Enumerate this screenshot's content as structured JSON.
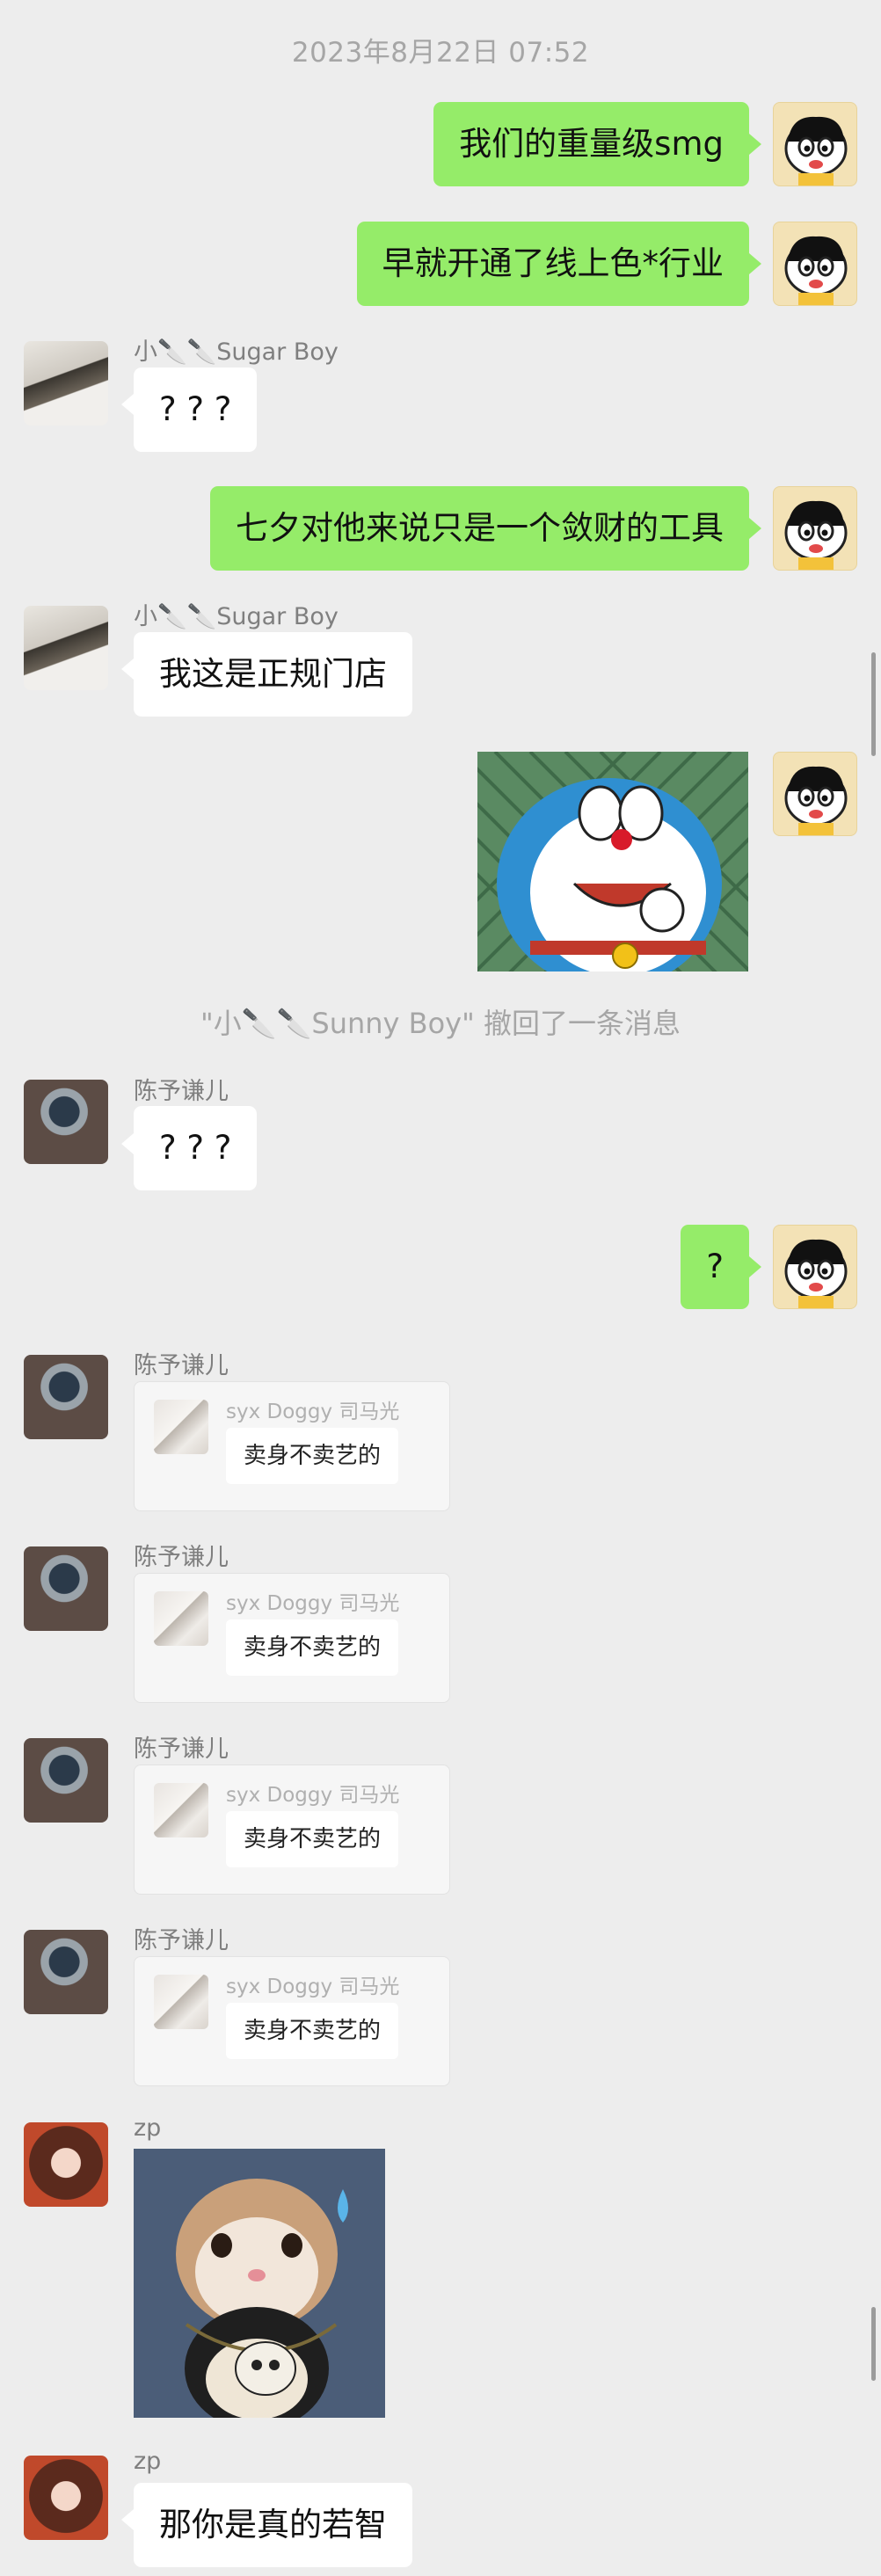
{
  "header": {
    "timestamp": "2023年8月22日 07:52"
  },
  "names": {
    "sugar": "小🔪🔪Sugar Boy",
    "chen": "陈予谦儿",
    "zp": "zp"
  },
  "messages": {
    "m1": "我们的重量级smg",
    "m2": "早就开通了线上色*行业",
    "m3": "? ? ?",
    "m4": "七夕对他来说只是一个敛财的工具",
    "m5": "我这是正规门店",
    "recall": "\"小🔪🔪Sunny Boy\" 撤回了一条消息",
    "m6": "? ? ?",
    "m7": "?",
    "m8": "那你是真的若智"
  },
  "quote_card": {
    "name": "syx Doggy 司马光",
    "text": "卖身不卖艺的"
  },
  "colors": {
    "background": "#ededed",
    "self_bubble": "#95ec69",
    "other_bubble": "#ffffff"
  },
  "icons": [
    "self-avatar-icon",
    "doraemon-sticker",
    "cat-sticker"
  ]
}
